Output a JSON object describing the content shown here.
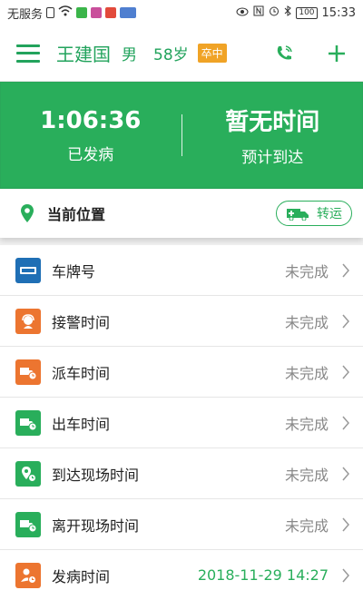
{
  "status_bar": {
    "carrier": "无服务",
    "battery": "100",
    "time": "15:33"
  },
  "header": {
    "patient_name": "王建国",
    "sex": "男",
    "age": "58岁",
    "tag": "卒中"
  },
  "banner": {
    "elapsed_value": "1:06:36",
    "elapsed_label": "已发病",
    "eta_value": "暂无时间",
    "eta_label": "预计到达"
  },
  "location": {
    "label": "当前位置",
    "transfer_button": "转运"
  },
  "rows": [
    {
      "label": "车牌号",
      "value": "未完成",
      "icon": "license-plate-icon",
      "color": "#1f6fb5"
    },
    {
      "label": "接警时间",
      "value": "未完成",
      "icon": "operator-headset-icon",
      "color": "#ec7530"
    },
    {
      "label": "派车时间",
      "value": "未完成",
      "icon": "ambulance-clock-icon",
      "color": "#ec7530"
    },
    {
      "label": "出车时间",
      "value": "未完成",
      "icon": "ambulance-clock-icon",
      "color": "#29ae5b"
    },
    {
      "label": "到达现场时间",
      "value": "未完成",
      "icon": "location-clock-icon",
      "color": "#29ae5b"
    },
    {
      "label": "离开现场时间",
      "value": "未完成",
      "icon": "ambulance-clock-icon",
      "color": "#29ae5b"
    },
    {
      "label": "发病时间",
      "value": "2018-11-29 14:27",
      "icon": "person-clock-icon",
      "color": "#ec7530"
    }
  ],
  "colors": {
    "brand_green": "#29ae5b",
    "tag_orange": "#f0a326",
    "icon_orange": "#ec7530",
    "icon_blue": "#1f6fb5"
  }
}
